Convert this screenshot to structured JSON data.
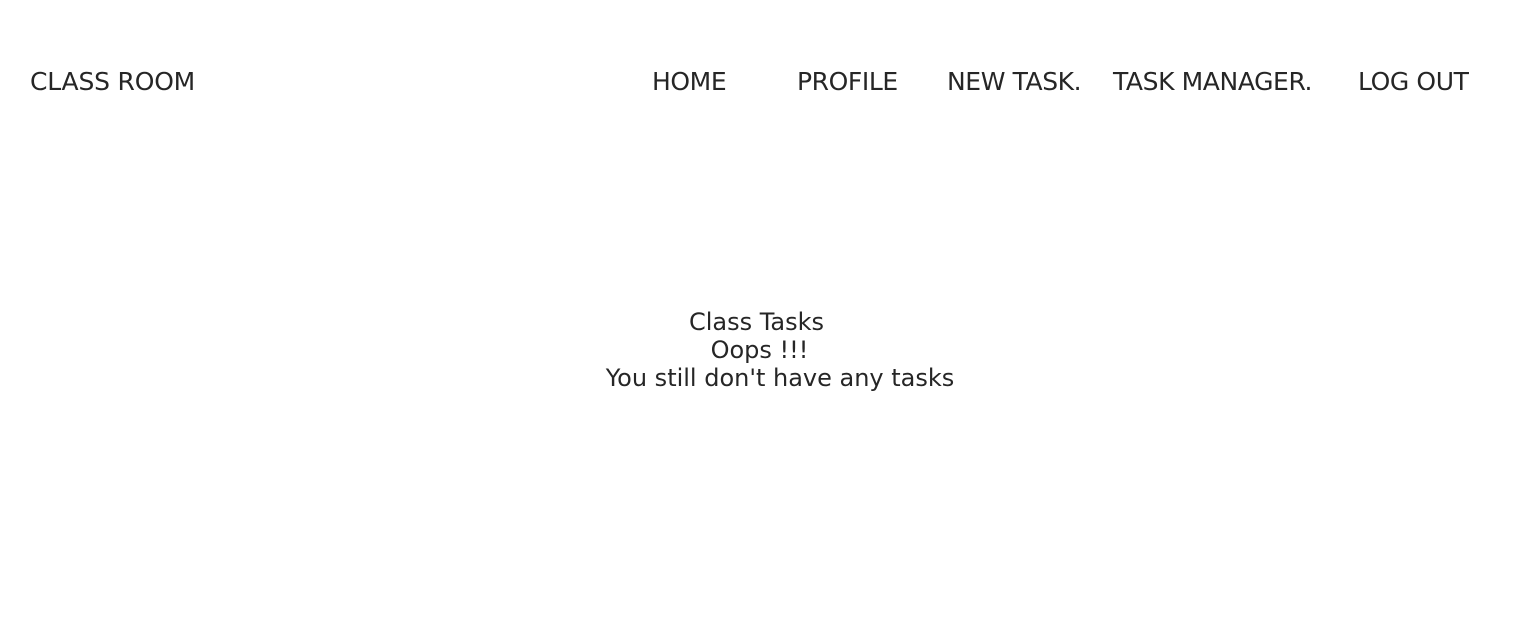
{
  "brand": "CLASS ROOM",
  "nav": {
    "home": "HOME",
    "profile": "PROFILE",
    "new_task": "NEW TASK.",
    "task_manager": "TASK MANAGER.",
    "log_out": "LOG OUT"
  },
  "main": {
    "title": "Class Tasks",
    "oops": "Oops !!!",
    "message": "You still don't have any tasks"
  }
}
